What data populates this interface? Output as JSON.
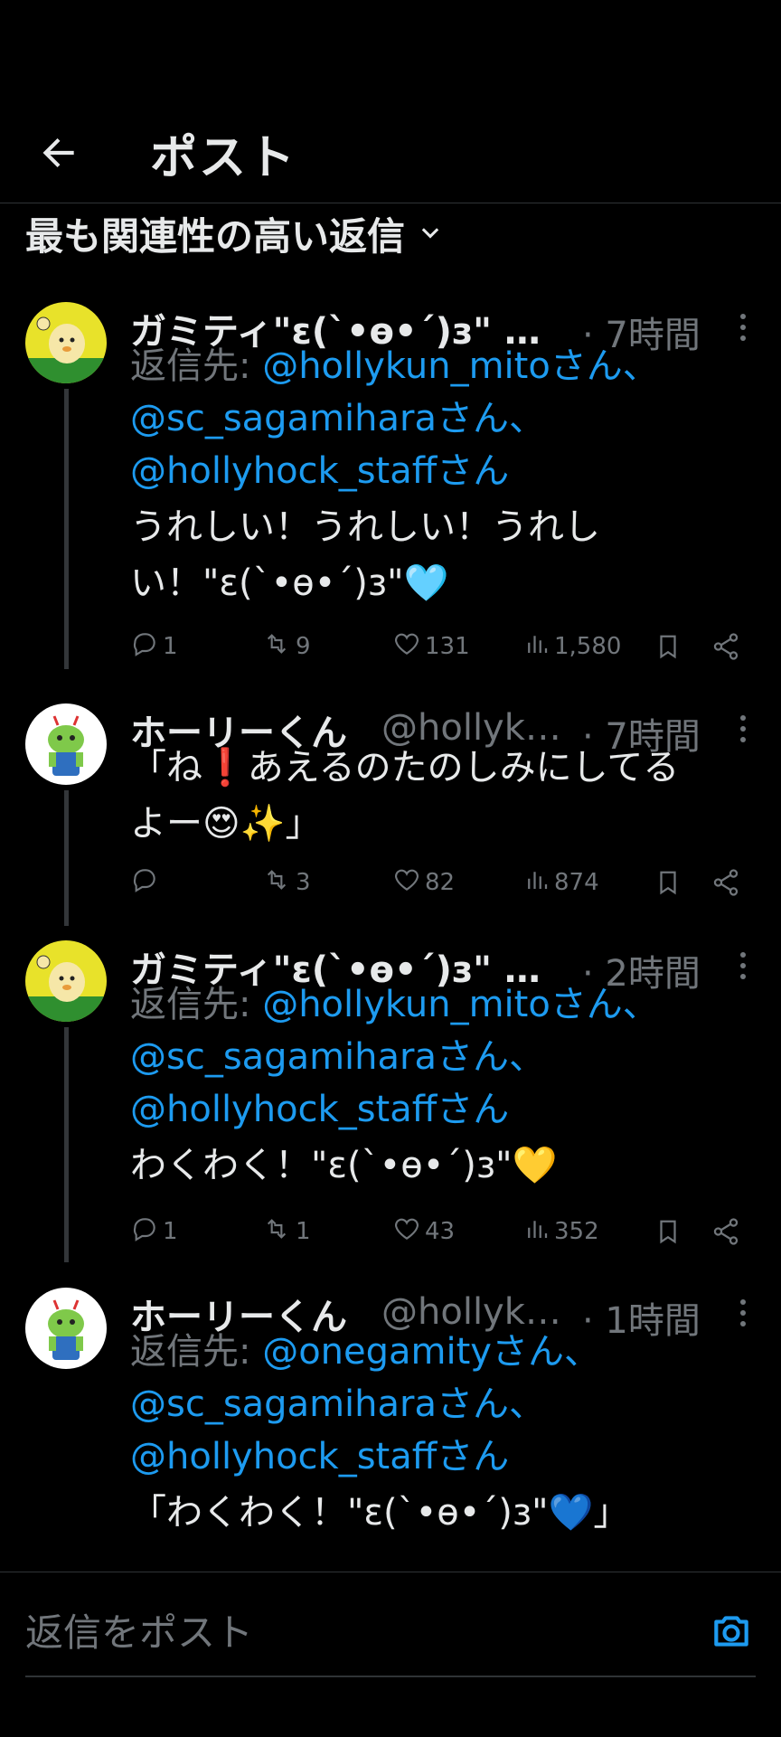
{
  "header": {
    "title": "ポスト"
  },
  "sort": {
    "label": "最も関連性の高い返信"
  },
  "posts": [
    {
      "display_name": "ガミティ\"ε(`•ө•´)з\" …",
      "handle": "",
      "time": "· 7時間",
      "reply_prefix": "返信先: ",
      "mentions": [
        "@hollykun_mitoさん、",
        "@sc_sagamiharaさん、",
        "@hollyhock_staffさん"
      ],
      "text_lines": [
        "うれしい！うれしい！うれし",
        "い！\"ε(`•ө•´)з\"🩵"
      ],
      "replies": "1",
      "reposts": "9",
      "likes": "131",
      "views": "1,580"
    },
    {
      "display_name": "ホーリーくん",
      "handle": "@hollyk…",
      "time": "· 7時間",
      "reply_prefix": "",
      "mentions": [],
      "text_lines": [
        "「ね❗あえるのたのしみにしてる",
        "よー😍✨」"
      ],
      "replies": "",
      "reposts": "3",
      "likes": "82",
      "views": "874"
    },
    {
      "display_name": "ガミティ\"ε(`•ө•´)з\" …",
      "handle": "",
      "time": "· 2時間",
      "reply_prefix": "返信先: ",
      "mentions": [
        "@hollykun_mitoさん、",
        "@sc_sagamiharaさん、",
        "@hollyhock_staffさん"
      ],
      "text_lines": [
        "わくわく！\"ε(`•ө•´)з\"💛"
      ],
      "replies": "1",
      "reposts": "1",
      "likes": "43",
      "views": "352"
    },
    {
      "display_name": "ホーリーくん",
      "handle": "@hollyk…",
      "time": "· 1時間",
      "reply_prefix": "返信先: ",
      "mentions": [
        "@onegamityさん、",
        "@sc_sagamiharaさん、",
        "@hollyhock_staffさん"
      ],
      "text_lines": [
        "「わくわく！\"ε(`•ө•´)з\"💙」"
      ],
      "replies": "",
      "reposts": "",
      "likes": "",
      "views": ""
    }
  ],
  "reply_box": {
    "placeholder": "返信をポスト"
  },
  "colors": {
    "accent": "#1d9bf0",
    "muted": "#71767b",
    "text": "#e7e9ea",
    "background": "#000000"
  },
  "icons": [
    "back-arrow-icon",
    "chevron-down-icon",
    "more-icon",
    "reply-icon",
    "repost-icon",
    "like-icon",
    "views-icon",
    "bookmark-icon",
    "share-icon",
    "camera-icon"
  ]
}
